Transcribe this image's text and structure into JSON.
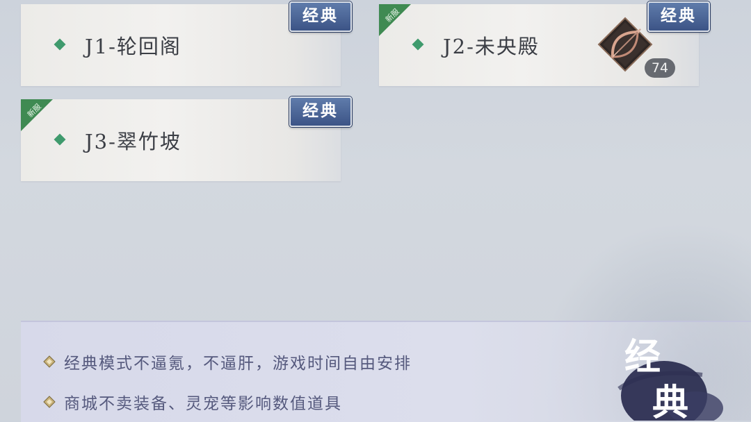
{
  "maps": [
    {
      "name": "J1-轮回阁",
      "tag": "经典",
      "new": false
    },
    {
      "name": "J2-未央殿",
      "tag": "经典",
      "new": true,
      "new_label": "新服",
      "item": {
        "icon": "bow-icon",
        "level": "74"
      }
    },
    {
      "name": "J3-翠竹坡",
      "tag": "经典",
      "new": true,
      "new_label": "新服"
    }
  ],
  "info": {
    "lines": [
      "经典模式不逼氪，不逼肝，游戏时间自由安排",
      "商城不卖装备、灵宠等影响数值道具"
    ],
    "stamp": "经典"
  },
  "colors": {
    "accent_green": "#3f9a6d",
    "tag_blue": "#3c5486",
    "info_text": "#55597d"
  }
}
